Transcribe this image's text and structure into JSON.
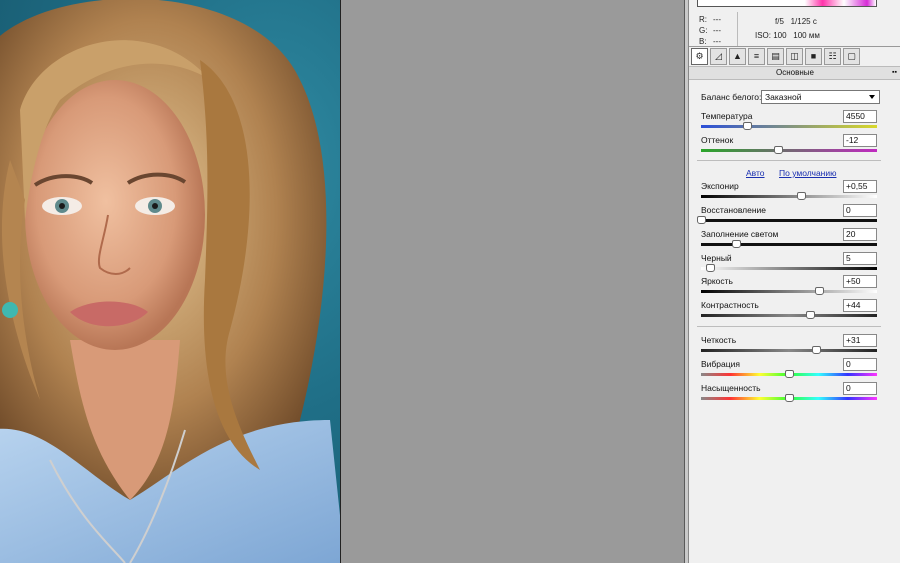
{
  "info": {
    "r_label": "R:",
    "r_value": "---",
    "g_label": "G:",
    "g_value": "---",
    "b_label": "B:",
    "b_value": "---",
    "aperture": "f/5",
    "shutter": "1/125 с",
    "iso": "ISO: 100",
    "focal": "100 мм"
  },
  "tabs": [
    "basic-icon",
    "tone-curve-icon",
    "detail-icon",
    "hsl-icon",
    "split-toning-icon",
    "lens-icon",
    "effects-icon",
    "camera-calibration-icon",
    "presets-icon"
  ],
  "section_title": "Основные",
  "white_balance": {
    "label": "Баланс белого:",
    "value": "Заказной"
  },
  "auto_link": "Авто",
  "default_link": "По умолчанию",
  "sliders": {
    "temperature": {
      "label": "Температура",
      "value": "4550",
      "level": 0.26
    },
    "tint": {
      "label": "Оттенок",
      "value": "-12",
      "level": 0.44
    },
    "exposure": {
      "label": "Экспонир",
      "value": "+0,55",
      "level": 0.57
    },
    "recovery": {
      "label": "Восстановление",
      "value": "0",
      "level": 0.0
    },
    "fill_light": {
      "label": "Заполнение светом",
      "value": "20",
      "level": 0.2
    },
    "blacks": {
      "label": "Черный",
      "value": "5",
      "level": 0.05
    },
    "brightness": {
      "label": "Яркость",
      "value": "+50",
      "level": 0.67
    },
    "contrast": {
      "label": "Контрастность",
      "value": "+44",
      "level": 0.62
    },
    "clarity": {
      "label": "Четкость",
      "value": "+31",
      "level": 0.655
    },
    "vibrance": {
      "label": "Вибрация",
      "value": "0",
      "level": 0.5
    },
    "saturation": {
      "label": "Насыщенность",
      "value": "0",
      "level": 0.5
    }
  },
  "colors": {
    "temp_gradient": [
      "#2b4fd8",
      "#d8d82b"
    ],
    "tint_gradient": [
      "#2aa52a",
      "#c02ac0"
    ],
    "link": "#1a2fb0"
  }
}
